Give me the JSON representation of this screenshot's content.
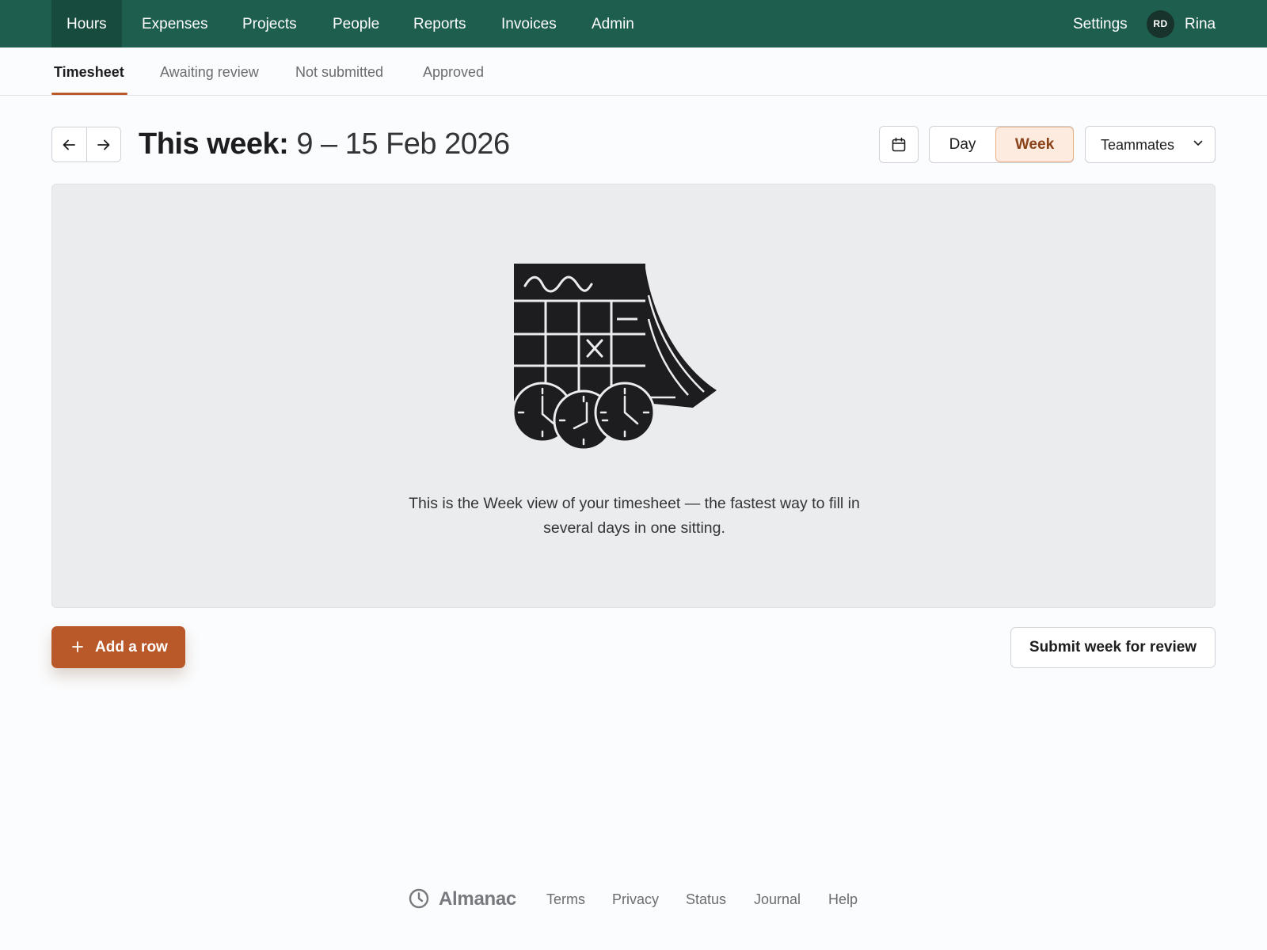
{
  "nav": {
    "items": [
      {
        "label": "Hours",
        "active": true
      },
      {
        "label": "Expenses"
      },
      {
        "label": "Projects"
      },
      {
        "label": "People"
      },
      {
        "label": "Reports"
      },
      {
        "label": "Invoices"
      },
      {
        "label": "Admin"
      }
    ],
    "settings_label": "Settings",
    "user_initials": "RD",
    "user_name": "Rina"
  },
  "subtabs": [
    {
      "label": "Timesheet",
      "active": true
    },
    {
      "label": "Awaiting review"
    },
    {
      "label": "Not submitted"
    },
    {
      "label": "Approved"
    }
  ],
  "header": {
    "title_label": "This week:",
    "title_range": " 9 – 15 Feb 2026",
    "view_day": "Day",
    "view_week": "Week",
    "selected_view": "Week",
    "teammates_label": "Teammates"
  },
  "empty_state": {
    "message": "This is the Week view of your timesheet — the fastest way to fill in several days in one sitting."
  },
  "actions": {
    "add_row_label": "Add a row",
    "submit_label": "Submit week for review"
  },
  "footer": {
    "brand": "Almanac",
    "links": [
      "Terms",
      "Privacy",
      "Status",
      "Journal",
      "Help"
    ]
  },
  "colors": {
    "nav_bg": "#1d5e4e",
    "nav_active_bg": "#164b3e",
    "accent": "#b9592a",
    "week_selected_bg": "#fcebde",
    "panel_bg": "#ebecee"
  }
}
